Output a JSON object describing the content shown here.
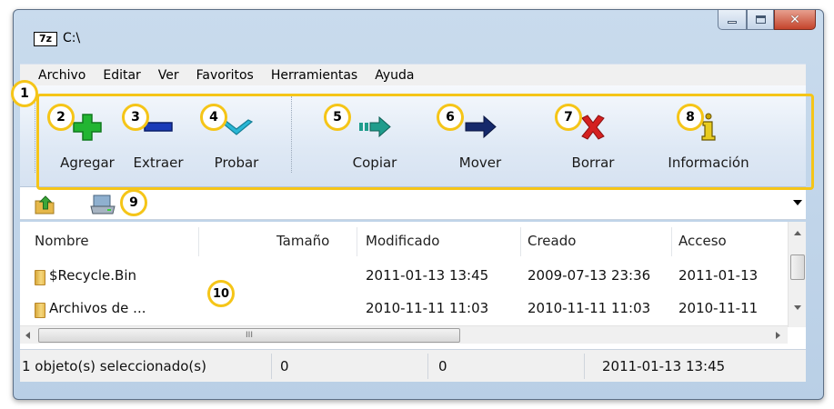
{
  "window": {
    "title": "C:\\",
    "app_icon_text": "7z",
    "close_glyph": "✕"
  },
  "menu": [
    "Archivo",
    "Editar",
    "Ver",
    "Favoritos",
    "Herramientas",
    "Ayuda"
  ],
  "toolbar": {
    "add_label": "Agregar",
    "extract_label": "Extraer",
    "test_label": "Probar",
    "copy_label": "Copiar",
    "move_label": "Mover",
    "delete_label": "Borrar",
    "info_label": "Información"
  },
  "columns": {
    "name": "Nombre",
    "size": "Tamaño",
    "modified": "Modificado",
    "created": "Creado",
    "accessed": "Acceso"
  },
  "rows": [
    {
      "name": "$Recycle.Bin",
      "size": "",
      "modified": "2011-01-13 13:45",
      "created": "2009-07-13 23:36",
      "accessed": "2011-01-13"
    },
    {
      "name": "Archivos de ...",
      "size": "",
      "modified": "2010-11-11 11:03",
      "created": "2010-11-11 11:03",
      "accessed": "2010-11-11"
    }
  ],
  "hscroll_grip": "III",
  "status": {
    "selected": "1 objeto(s) seleccionado(s)",
    "size": "0",
    "packed": "0",
    "modified": "2011-01-13 13:45"
  },
  "callouts": [
    "1",
    "2",
    "3",
    "4",
    "5",
    "6",
    "7",
    "8",
    "9",
    "10"
  ],
  "colors": {
    "callout_accent": "#f5c518",
    "add_green": "#22b532",
    "extract_blue": "#1a3bb8",
    "test_cyan": "#29b7d6",
    "copy_teal": "#1f9c8c",
    "move_navy": "#15296b",
    "delete_red": "#d42020",
    "info_yellow": "#c9a400"
  }
}
